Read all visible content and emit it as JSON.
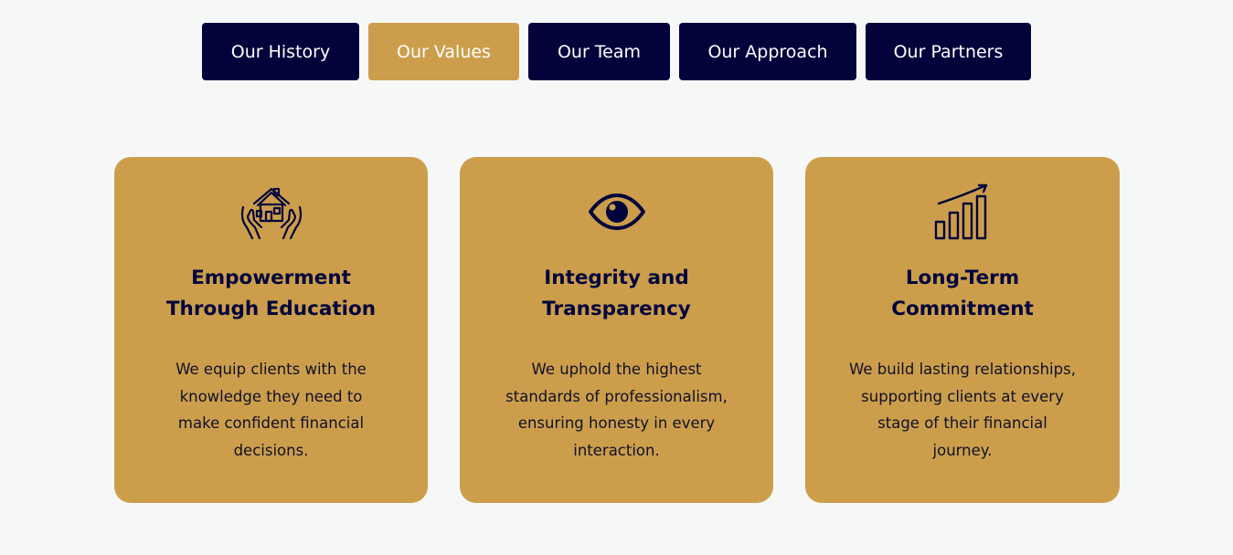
{
  "tabs": [
    {
      "label": "Our History",
      "active": false
    },
    {
      "label": "Our Values",
      "active": true
    },
    {
      "label": "Our Team",
      "active": false
    },
    {
      "label": "Our Approach",
      "active": false
    },
    {
      "label": "Our Partners",
      "active": false
    }
  ],
  "cards": [
    {
      "icon": "hands-house-icon",
      "title_line1": "Empowerment",
      "title_line2": "Through Education",
      "text": "We equip clients with the knowledge they need to make confident financial decisions."
    },
    {
      "icon": "eye-icon",
      "title_line1": "Integrity and",
      "title_line2": "Transparency",
      "text": "We uphold the highest standards of professionalism, ensuring honesty in every interaction."
    },
    {
      "icon": "growth-chart-icon",
      "title_line1": "Long-Term",
      "title_line2": "Commitment",
      "text": "We build lasting relationships, supporting clients at every stage of their financial journey."
    }
  ],
  "colors": {
    "navy": "#02033b",
    "gold": "#cc9e4c",
    "background": "#f6f8f7"
  }
}
